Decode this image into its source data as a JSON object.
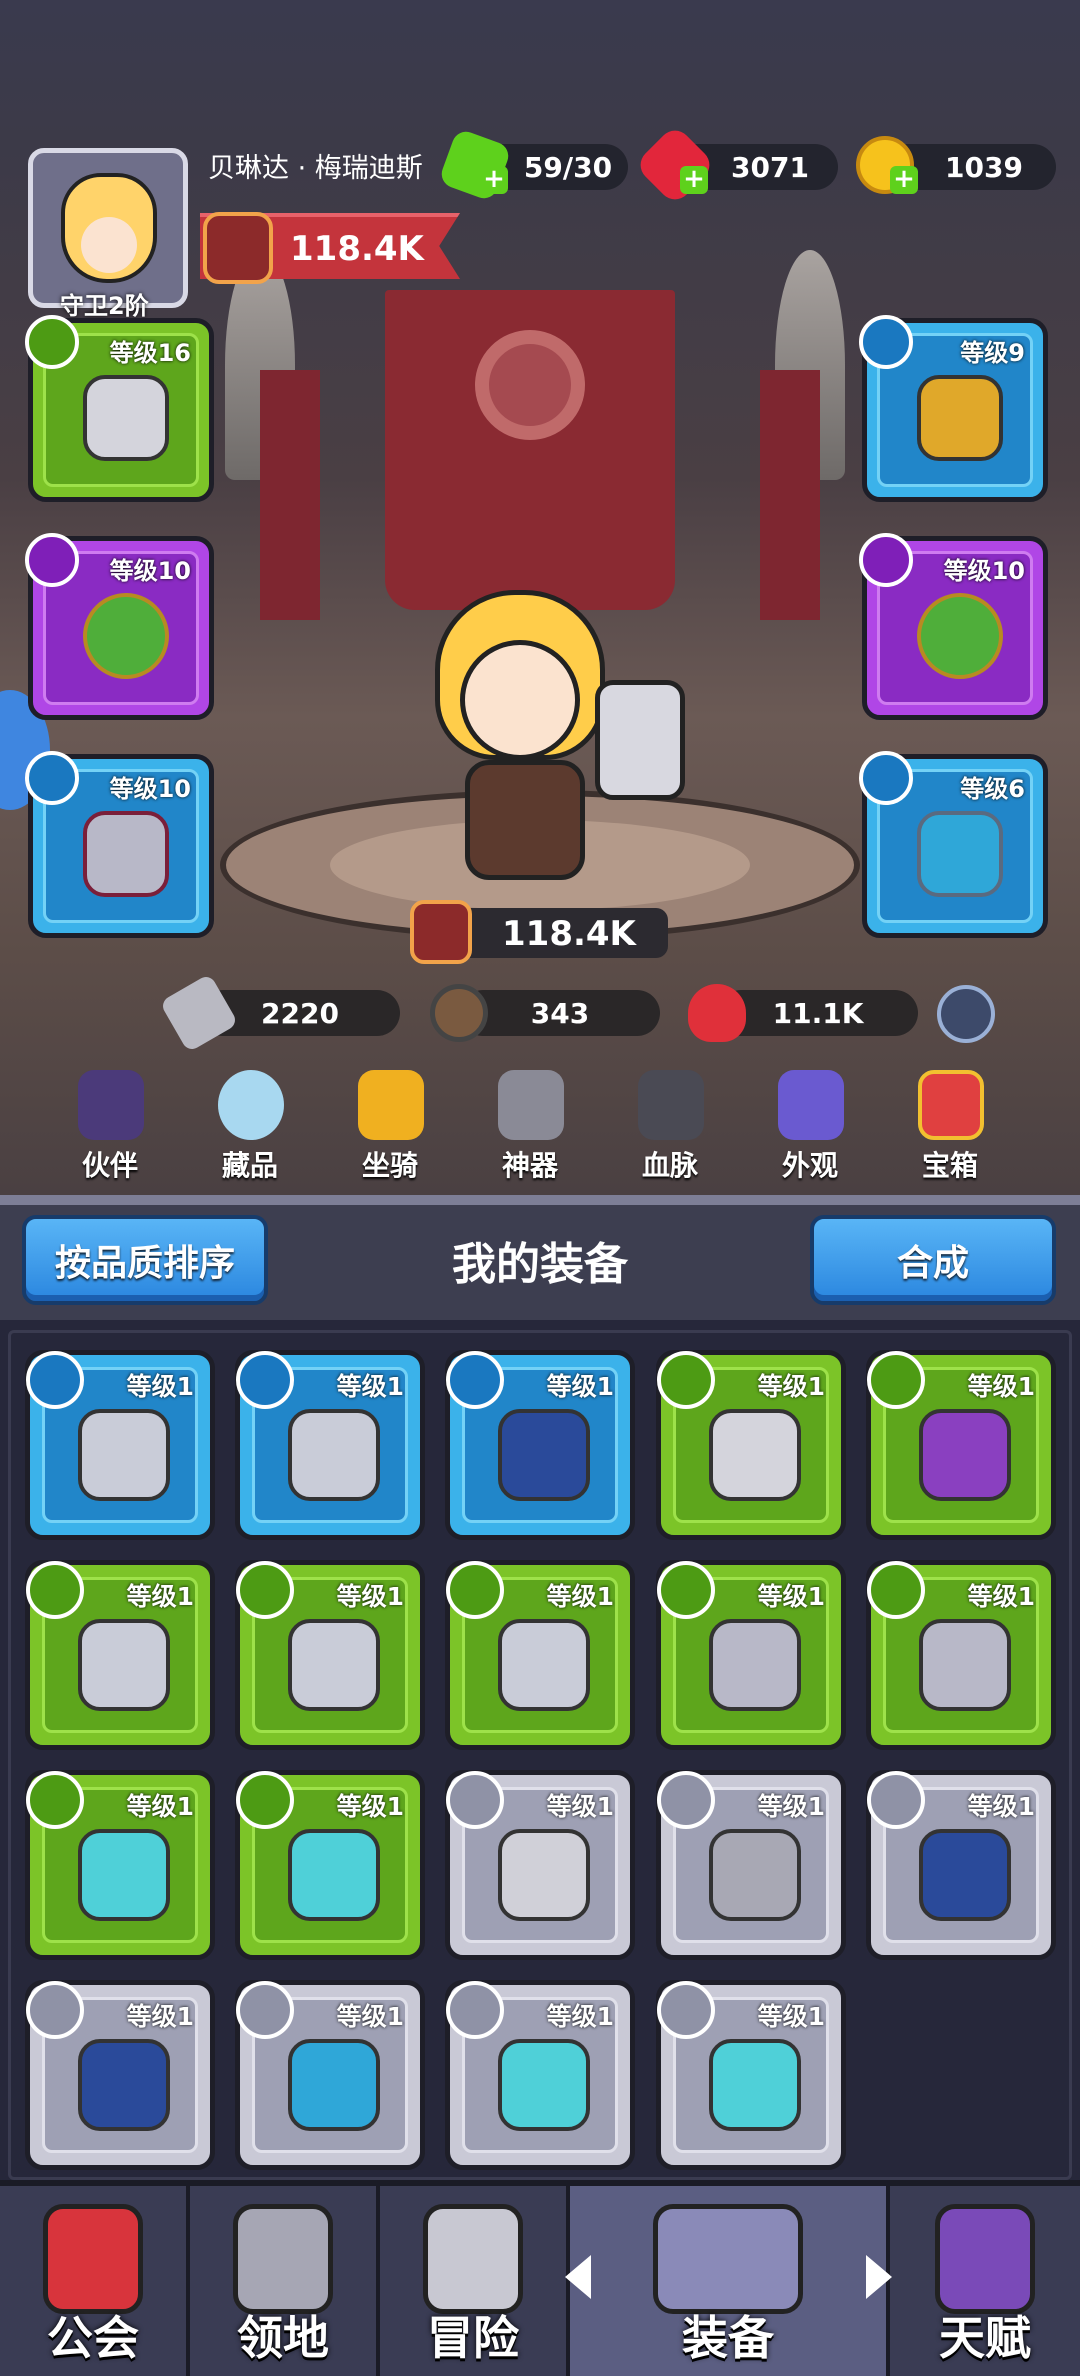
{
  "hero": {
    "name": "贝琳达 · 梅瑞迪斯",
    "rank": "守卫2阶",
    "power": "118.4K"
  },
  "resources": [
    {
      "name": "stamina",
      "value": "59/30",
      "color": "#5ed11c"
    },
    {
      "name": "gems",
      "value": "3071",
      "color": "#e2263b"
    },
    {
      "name": "gold",
      "value": "1039",
      "color": "#f6c21c"
    }
  ],
  "equipped": [
    {
      "slot": "weapon",
      "level": "等级16",
      "rarity": "green",
      "icon": "hammer-icon"
    },
    {
      "slot": "armor",
      "level": "等级9",
      "rarity": "blue",
      "icon": "armor-icon"
    },
    {
      "slot": "ring-left",
      "level": "等级10",
      "rarity": "purple",
      "icon": "ring-icon"
    },
    {
      "slot": "ring-right",
      "level": "等级10",
      "rarity": "purple",
      "icon": "ring-icon"
    },
    {
      "slot": "necklace",
      "level": "等级10",
      "rarity": "blue",
      "icon": "necklace-icon"
    },
    {
      "slot": "amulet",
      "level": "等级6",
      "rarity": "blue",
      "icon": "amulet-icon"
    }
  ],
  "combat_power": "118.4K",
  "stats": {
    "attack": "2220",
    "defense": "343",
    "hp": "11.1K"
  },
  "tabs": [
    "伙伴",
    "藏品",
    "坐骑",
    "神器",
    "血脉",
    "外观",
    "宝箱"
  ],
  "panel": {
    "sort_button": "按品质排序",
    "title": "我的装备",
    "merge_button": "合成"
  },
  "inventory": [
    {
      "level": "等级1",
      "rarity": "blue",
      "icon": "armor-icon"
    },
    {
      "level": "等级1",
      "rarity": "blue",
      "icon": "armor-icon"
    },
    {
      "level": "等级1",
      "rarity": "blue",
      "icon": "ring-icon"
    },
    {
      "level": "等级1",
      "rarity": "green",
      "icon": "axe-icon"
    },
    {
      "level": "等级1",
      "rarity": "green",
      "icon": "staff-icon"
    },
    {
      "level": "等级1",
      "rarity": "green",
      "icon": "armor-icon"
    },
    {
      "level": "等级1",
      "rarity": "green",
      "icon": "armor-icon"
    },
    {
      "level": "等级1",
      "rarity": "green",
      "icon": "armor-icon"
    },
    {
      "level": "等级1",
      "rarity": "green",
      "icon": "necklace-icon"
    },
    {
      "level": "等级1",
      "rarity": "green",
      "icon": "necklace-icon"
    },
    {
      "level": "等级1",
      "rarity": "green",
      "icon": "mask-icon"
    },
    {
      "level": "等级1",
      "rarity": "green",
      "icon": "mask-icon"
    },
    {
      "level": "等级1",
      "rarity": "grey",
      "icon": "hammer-icon"
    },
    {
      "level": "等级1",
      "rarity": "grey",
      "icon": "spear-icon"
    },
    {
      "level": "等级1",
      "rarity": "grey",
      "icon": "ring-icon"
    },
    {
      "level": "等级1",
      "rarity": "grey",
      "icon": "ring-icon"
    },
    {
      "level": "等级1",
      "rarity": "grey",
      "icon": "amulet-icon"
    },
    {
      "level": "等级1",
      "rarity": "grey",
      "icon": "mask-icon"
    },
    {
      "level": "等级1",
      "rarity": "grey",
      "icon": "mask-icon"
    }
  ],
  "nav": [
    "公会",
    "领地",
    "冒险",
    "装备",
    "天赋"
  ],
  "active_nav": "装备"
}
